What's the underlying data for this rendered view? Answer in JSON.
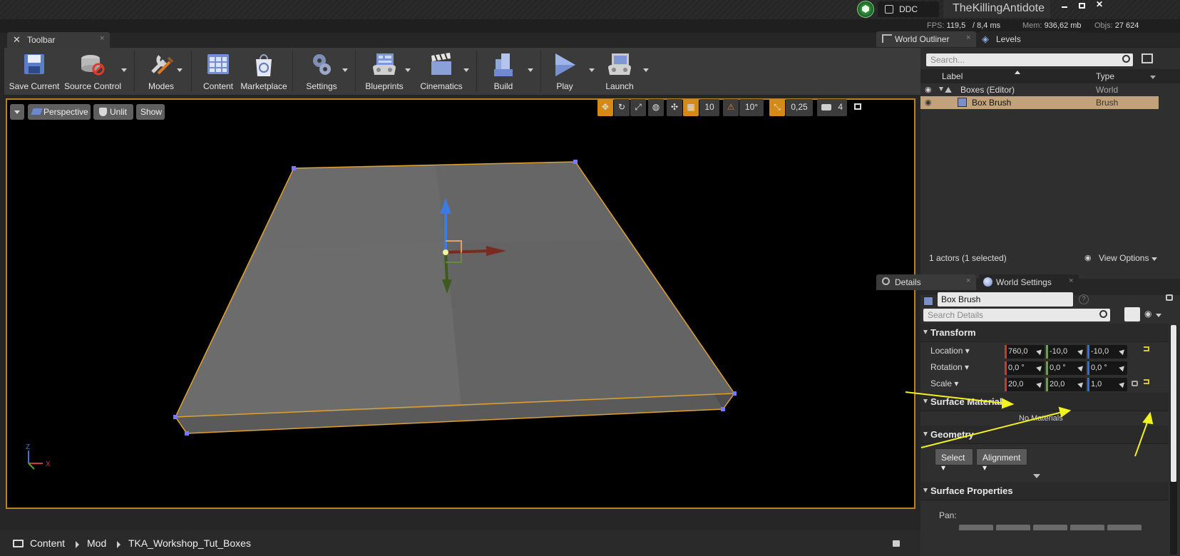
{
  "titlebar": {
    "ddc_label": "DDC",
    "project_name": "TheKillingAntidote",
    "window_controls": [
      "minimize",
      "restore",
      "close"
    ]
  },
  "stats": {
    "fps_label": "FPS:",
    "fps_value": "119,5",
    "ms_value": "/ 8,4 ms",
    "mem_label": "Mem:",
    "mem_value": "936,62 mb",
    "objs_label": "Objs:",
    "objs_value": "27 624"
  },
  "toolbar": {
    "tab_label": "Toolbar",
    "buttons": [
      {
        "label": "Save Current",
        "icon": "save-icon"
      },
      {
        "label": "Source Control",
        "icon": "source-control-icon"
      },
      {
        "label": "Modes",
        "icon": "modes-icon"
      },
      {
        "label": "Content",
        "icon": "content-icon"
      },
      {
        "label": "Marketplace",
        "icon": "marketplace-icon"
      },
      {
        "label": "Settings",
        "icon": "settings-icon"
      },
      {
        "label": "Blueprints",
        "icon": "blueprints-icon"
      },
      {
        "label": "Cinematics",
        "icon": "cinematics-icon"
      },
      {
        "label": "Build",
        "icon": "build-icon"
      },
      {
        "label": "Play",
        "icon": "play-icon"
      },
      {
        "label": "Launch",
        "icon": "launch-icon"
      }
    ]
  },
  "viewport": {
    "perspective_label": "Perspective",
    "unlit_label": "Unlit",
    "show_label": "Show",
    "grid_snap": "10",
    "rotation_snap": "10°",
    "scale_snap": "0,25",
    "camera_speed": "4",
    "axis_labels": {
      "x": "X",
      "z": "Z"
    }
  },
  "outliner": {
    "tab_label": "World Outliner",
    "levels_tab_label": "Levels",
    "search_placeholder": "Search...",
    "col_label": "Label",
    "col_type": "Type",
    "rows": [
      {
        "label": "Boxes (Editor)",
        "type": "World"
      },
      {
        "label": "Box Brush",
        "type": "Brush"
      }
    ],
    "actor_count": "1 actors (1 selected)",
    "view_options": "View Options"
  },
  "details": {
    "tab_label": "Details",
    "world_settings_label": "World Settings",
    "object_name": "Box Brush",
    "search_placeholder": "Search Details",
    "transform_label": "Transform",
    "location_label": "Location",
    "rotation_label": "Rotation",
    "scale_label": "Scale",
    "location": [
      "760,0",
      "-10,0",
      "-10,0"
    ],
    "rotation": [
      "0,0 °",
      "0,0 °",
      "0,0 °"
    ],
    "scale": [
      "20,0",
      "20,0",
      "1,0"
    ],
    "surface_materials_label": "Surface Materials",
    "no_materials": "No Materials",
    "geometry_label": "Geometry",
    "select_label": "Select",
    "alignment_label": "Alignment",
    "surface_properties_label": "Surface Properties",
    "pan_label": "Pan:"
  },
  "content_browser": {
    "breadcrumbs": [
      "Content",
      "Mod",
      "TKA_Workshop_Tut_Boxes"
    ]
  },
  "colors": {
    "accent": "#d48a16",
    "selection": "#c2a27a",
    "x_axis": "#c53b2c",
    "y_axis": "#5fae2b",
    "z_axis": "#2f6fd6",
    "annotation": "#f2f21e"
  }
}
